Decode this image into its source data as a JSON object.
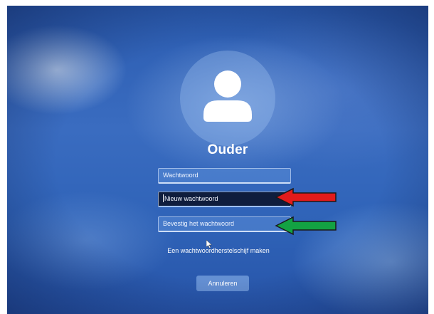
{
  "user": {
    "name": "Ouder"
  },
  "form": {
    "current_password_placeholder": "Wachtwoord",
    "new_password_placeholder": "Nieuw wachtwoord",
    "confirm_password_placeholder": "Bevestig het wachtwoord",
    "reset_disk_link": "Een wachtwoordherstelschijf maken",
    "cancel_label": "Annuleren"
  },
  "annotations": {
    "new_password_arrow_color": "#e21b1b",
    "confirm_password_arrow_color": "#13a243"
  },
  "icons": {
    "avatar": "user-silhouette-icon",
    "pointer": "mouse-pointer-icon"
  }
}
